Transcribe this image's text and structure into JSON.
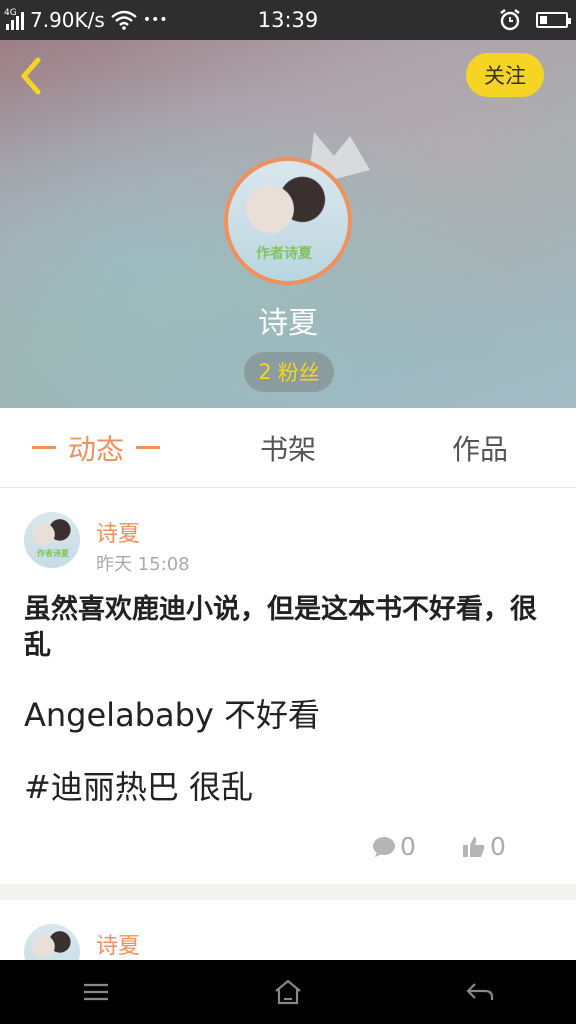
{
  "status_bar": {
    "network": "4G",
    "speed": "7.90K/s",
    "more": "•••",
    "time": "13:39",
    "battery_level": 0.3
  },
  "header": {
    "follow_label": "关注",
    "username": "诗夏",
    "fans_count": "2",
    "fans_label": "粉丝",
    "avatar_watermark": "作者诗夏"
  },
  "tabs": [
    {
      "label": "动态",
      "active": true
    },
    {
      "label": "书架",
      "active": false
    },
    {
      "label": "作品",
      "active": false
    }
  ],
  "posts": [
    {
      "author": "诗夏",
      "time": "昨天 15:08",
      "title": "虽然喜欢鹿迪小说，但是这本书不好看，很乱",
      "lines": [
        "Angelababy 不好看",
        "#迪丽热巴 很乱"
      ],
      "comments": "0",
      "likes": "0"
    },
    {
      "author": "诗夏"
    }
  ],
  "colors": {
    "accent": "#f0905c",
    "follow": "#f6d423"
  }
}
